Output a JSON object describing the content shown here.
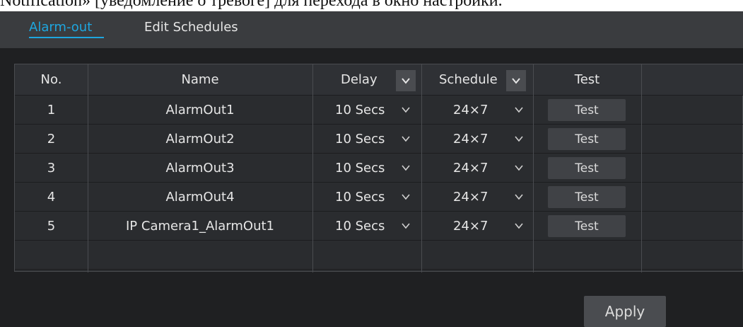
{
  "caption": "Notification» [уведомление о тревоге] для перехода в окно настройки.",
  "tabs": [
    {
      "label": "Alarm-out",
      "active": true
    },
    {
      "label": "Edit Schedules",
      "active": false
    }
  ],
  "columns": [
    "No.",
    "Name",
    "Delay",
    "Schedule",
    "Test"
  ],
  "rows": [
    {
      "no": "1",
      "name": "AlarmOut1",
      "delay": "10 Secs",
      "schedule": "24×7",
      "test": "Test"
    },
    {
      "no": "2",
      "name": "AlarmOut2",
      "delay": "10 Secs",
      "schedule": "24×7",
      "test": "Test"
    },
    {
      "no": "3",
      "name": "AlarmOut3",
      "delay": "10 Secs",
      "schedule": "24×7",
      "test": "Test"
    },
    {
      "no": "4",
      "name": "AlarmOut4",
      "delay": "10 Secs",
      "schedule": "24×7",
      "test": "Test"
    },
    {
      "no": "5",
      "name": "IP Camera1_AlarmOut1",
      "delay": "10 Secs",
      "schedule": "24×7",
      "test": "Test"
    }
  ],
  "apply_label": "Apply",
  "icons": {
    "dropdown": "chevron-down-icon"
  },
  "colors": {
    "accent": "#1ea6df",
    "panel": "#1f2022",
    "tabbar": "#3a3c3f"
  }
}
